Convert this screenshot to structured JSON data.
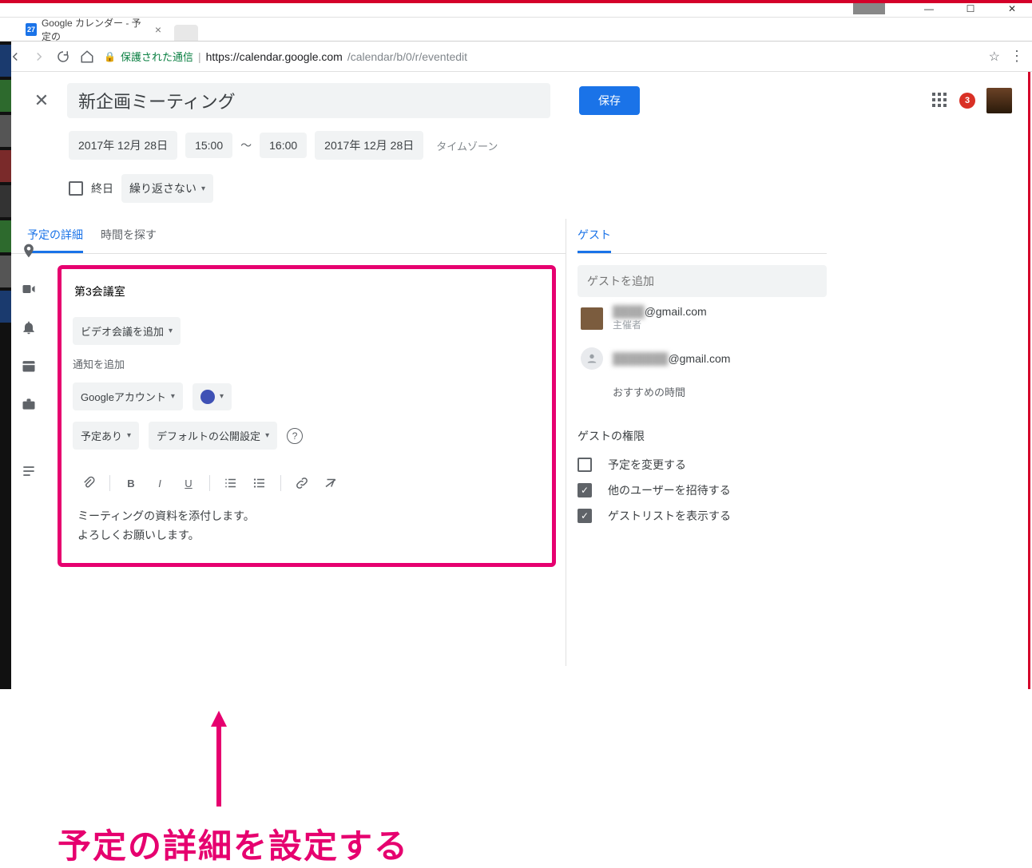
{
  "window": {
    "tab_title": "Google カレンダー - 予定の",
    "favicon_text": "27",
    "secure_label": "保護された通信",
    "url_host": "https://calendar.google.com",
    "url_path": "/calendar/b/0/r/eventedit"
  },
  "header": {
    "title_value": "新企画ミーティング",
    "save_label": "保存",
    "notif_count": "3"
  },
  "datetime": {
    "start_date": "2017年 12月 28日",
    "start_time": "15:00",
    "dash": "〜",
    "end_time": "16:00",
    "end_date": "2017年 12月 28日",
    "timezone_label": "タイムゾーン"
  },
  "allday": {
    "label": "終日",
    "repeat": "繰り返さない"
  },
  "tabs": {
    "details": "予定の詳細",
    "findtime": "時間を探す",
    "guests": "ゲスト"
  },
  "details": {
    "location": "第3会議室",
    "video_conf": "ビデオ会議を追加",
    "add_notification": "通知を追加",
    "calendar_account": "Googleアカウント",
    "busy": "予定あり",
    "visibility": "デフォルトの公開設定",
    "description_line1": "ミーティングの資料を添付します。",
    "description_line2": "よろしくお願いします。"
  },
  "guests": {
    "add_placeholder": "ゲストを追加",
    "g1_email_suffix": "@gmail.com",
    "g1_role": "主催者",
    "g2_email_suffix": "@gmail.com",
    "suggest": "おすすめの時間"
  },
  "permissions": {
    "heading": "ゲストの権限",
    "p1": "予定を変更する",
    "p2": "他のユーザーを招待する",
    "p3": "ゲストリストを表示する"
  },
  "annotation": {
    "caption": "予定の詳細を設定する"
  }
}
